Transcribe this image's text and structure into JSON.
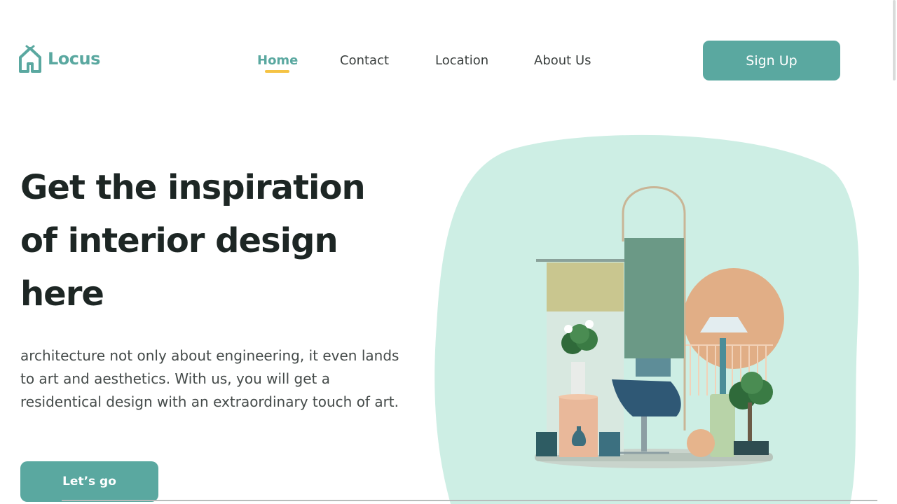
{
  "header": {
    "logo_text": "Locus",
    "nav": [
      {
        "label": "Home",
        "active": true
      },
      {
        "label": "Contact",
        "active": false
      },
      {
        "label": "Location",
        "active": false
      },
      {
        "label": "About Us",
        "active": false
      }
    ],
    "signup_label": "Sign Up"
  },
  "hero": {
    "title_lines": [
      "Get the inspiration",
      "of interior design",
      "here"
    ],
    "description": "architecture not only about engineering, it even lands to art and aesthetics. With us, you will get a residentical design with an extraordinary touch of art.",
    "cta_label": "Let’s go"
  },
  "icons": {
    "logo": "house-icon"
  },
  "colors": {
    "accent": "#5aa8a0",
    "underline": "#f5c344",
    "blob": "#cdeee4",
    "text_dark": "#1d2624"
  }
}
